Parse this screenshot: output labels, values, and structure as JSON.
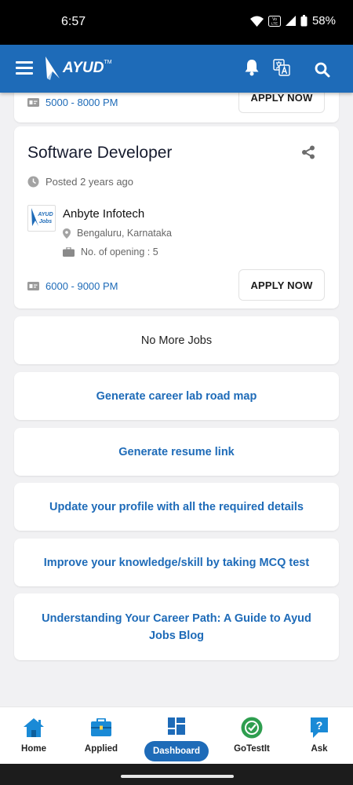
{
  "status_bar": {
    "time": "6:57",
    "battery": "58%",
    "network": "VoLTE"
  },
  "app_bar": {
    "logo_text": "AYUD",
    "logo_tm": "TM"
  },
  "previous_job": {
    "salary": "5000 - 8000 PM",
    "apply_label": "APPLY NOW"
  },
  "job": {
    "title": "Software Developer",
    "posted": "Posted 2 years ago",
    "company": "Anbyte Infotech",
    "company_logo_text": "AYUD Jobs",
    "location": "Bengaluru, Karnataka",
    "openings": "No. of opening : 5",
    "salary": "6000 - 9000 PM",
    "apply_label": "APPLY NOW"
  },
  "no_more_jobs": "No More Jobs",
  "links": [
    {
      "label": "Generate career lab road map"
    },
    {
      "label": "Generate resume link"
    },
    {
      "label": "Update your profile with all the required details"
    },
    {
      "label": "Improve your knowledge/skill by taking MCQ test"
    },
    {
      "label": "Understanding Your Career Path: A Guide to Ayud Jobs Blog"
    }
  ],
  "bottom_nav": [
    {
      "label": "Home",
      "icon": "home-icon"
    },
    {
      "label": "Applied",
      "icon": "briefcase-icon"
    },
    {
      "label": "Dashboard",
      "icon": "dashboard-icon",
      "active": true
    },
    {
      "label": "GoTestIt",
      "icon": "gotestit-icon"
    },
    {
      "label": "Ask",
      "icon": "question-icon"
    }
  ],
  "colors": {
    "primary": "#1e6bb8",
    "background": "#f1f1f3",
    "gotestit": "#2e9e4f",
    "ask": "#1a8ad6"
  }
}
